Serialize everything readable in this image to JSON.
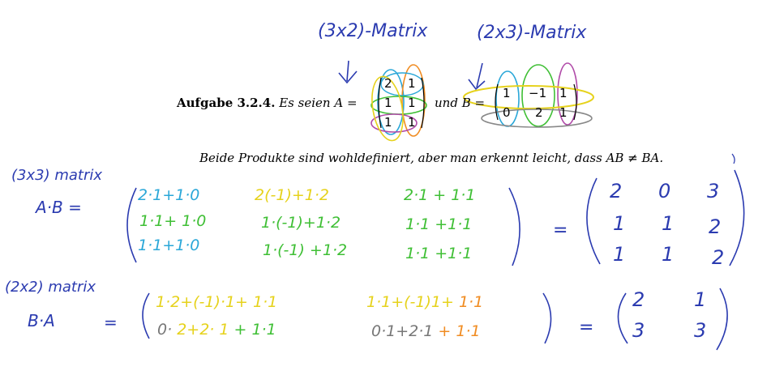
{
  "annotations": {
    "label_3x2": "(3x2)-Matrix",
    "label_2x3": "(2x3)-Matrix",
    "label_3x3": "(3x3) matrix",
    "label_2x2": "(2x2) matrix",
    "ab_label": "A·B =",
    "ba_label": "B·A",
    "ba_equals": "="
  },
  "task": {
    "number": "Aufgabe 3.2.4.",
    "text_1": "Es seien",
    "var_a": "A",
    "eq": "=",
    "and": "und",
    "var_b": "B",
    "eq2": "="
  },
  "matrix_a": [
    [
      "2",
      "1"
    ],
    [
      "1",
      "1"
    ],
    [
      "1",
      "1"
    ]
  ],
  "matrix_b": [
    [
      "1",
      "−1",
      "1"
    ],
    [
      "0",
      "2",
      "1"
    ]
  ],
  "statement": "Beide Produkte sind wohldefiniert, aber man erkennt leicht, dass AB ≠ BA.",
  "ab_product": {
    "rows": [
      [
        "2·1+1·0",
        "2(-1)+1·2",
        "2·1 + 1·1"
      ],
      [
        "1·1+ 1·0",
        "1·(-1)+1·2",
        "1·1 +1·1"
      ],
      [
        "1·1+1·0",
        "1·(-1) +1·2",
        "1·1 +1·1"
      ]
    ],
    "equals": "=",
    "result": [
      [
        "2",
        "0",
        "3"
      ],
      [
        "1",
        "1",
        "2"
      ],
      [
        "1",
        "1",
        "2"
      ]
    ]
  },
  "ba_product": {
    "row1": {
      "a": "1·2+(-1)·1+",
      "b": "1·1",
      "c": "1·1+(-1)1+",
      "d": "1·1"
    },
    "row2": {
      "a": "0·",
      "b": "2+2·",
      "c": "1",
      "d": "+ 1·1",
      "e": "0·1+2·1",
      "f": "+ 1·1"
    },
    "equals": "=",
    "result": [
      [
        "2",
        "1"
      ],
      [
        "3",
        "3"
      ]
    ]
  },
  "colors": {
    "ink_blue": "#2b3bb0",
    "cyan": "#2aa7d8",
    "green": "#3fbf35",
    "yellow": "#e6d21c",
    "orange": "#f08c22",
    "purple": "#b04aa8",
    "gray": "#888888"
  }
}
